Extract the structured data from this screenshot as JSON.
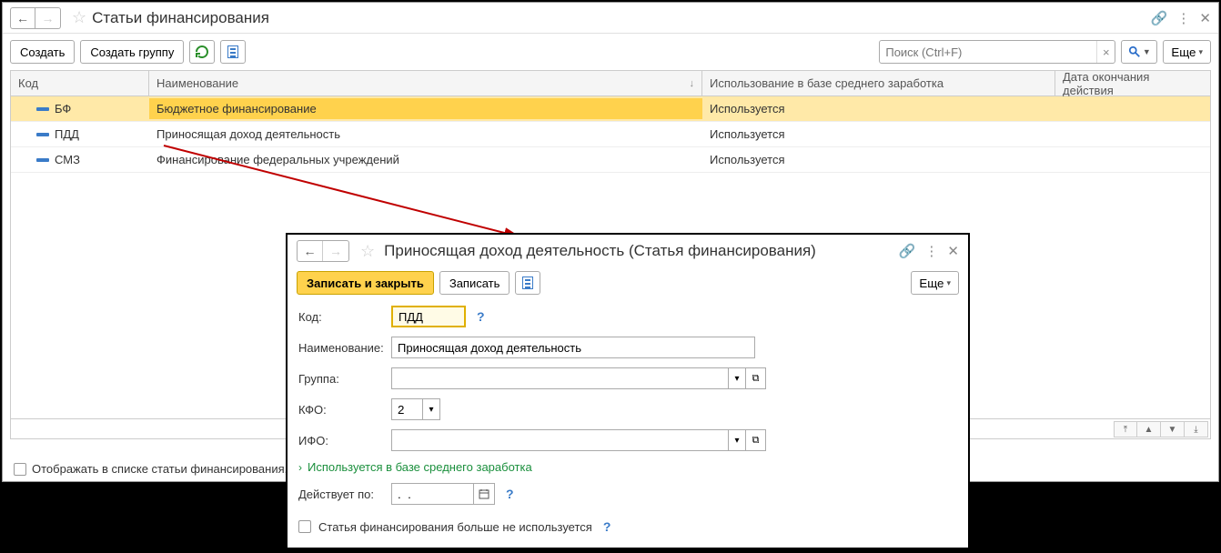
{
  "main": {
    "title": "Статьи финансирования",
    "create_label": "Создать",
    "create_group_label": "Создать группу",
    "search_placeholder": "Поиск (Ctrl+F)",
    "more_label": "Еще",
    "footer_checkbox_label": "Отображать в списке статьи финансирования,",
    "columns": {
      "code": "Код",
      "name": "Наименование",
      "use": "Использование в базе среднего заработка",
      "date": "Дата окончания действия"
    },
    "rows": [
      {
        "code": "БФ",
        "name": "Бюджетное финансирование",
        "use": "Используется",
        "date": "",
        "selected": true
      },
      {
        "code": "ПДД",
        "name": "Приносящая доход деятельность",
        "use": "Используется",
        "date": "",
        "selected": false
      },
      {
        "code": "СМЗ",
        "name": "Финансирование федеральных учреждений",
        "use": "Используется",
        "date": "",
        "selected": false
      }
    ]
  },
  "dialog": {
    "title": "Приносящая доход деятельность (Статья финансирования)",
    "save_close_label": "Записать и закрыть",
    "save_label": "Записать",
    "more_label": "Еще",
    "fields": {
      "code_label": "Код:",
      "code_value": "ПДД",
      "name_label": "Наименование:",
      "name_value": "Приносящая доход деятельность",
      "group_label": "Группа:",
      "group_value": "",
      "kfo_label": "КФО:",
      "kfo_value": "2",
      "ifo_label": "ИФО:",
      "ifo_value": "",
      "collapse_label": "Используется в базе среднего заработка",
      "valid_to_label": "Действует по:",
      "valid_to_value": ".  .",
      "not_used_label": "Статья финансирования больше не используется"
    }
  }
}
